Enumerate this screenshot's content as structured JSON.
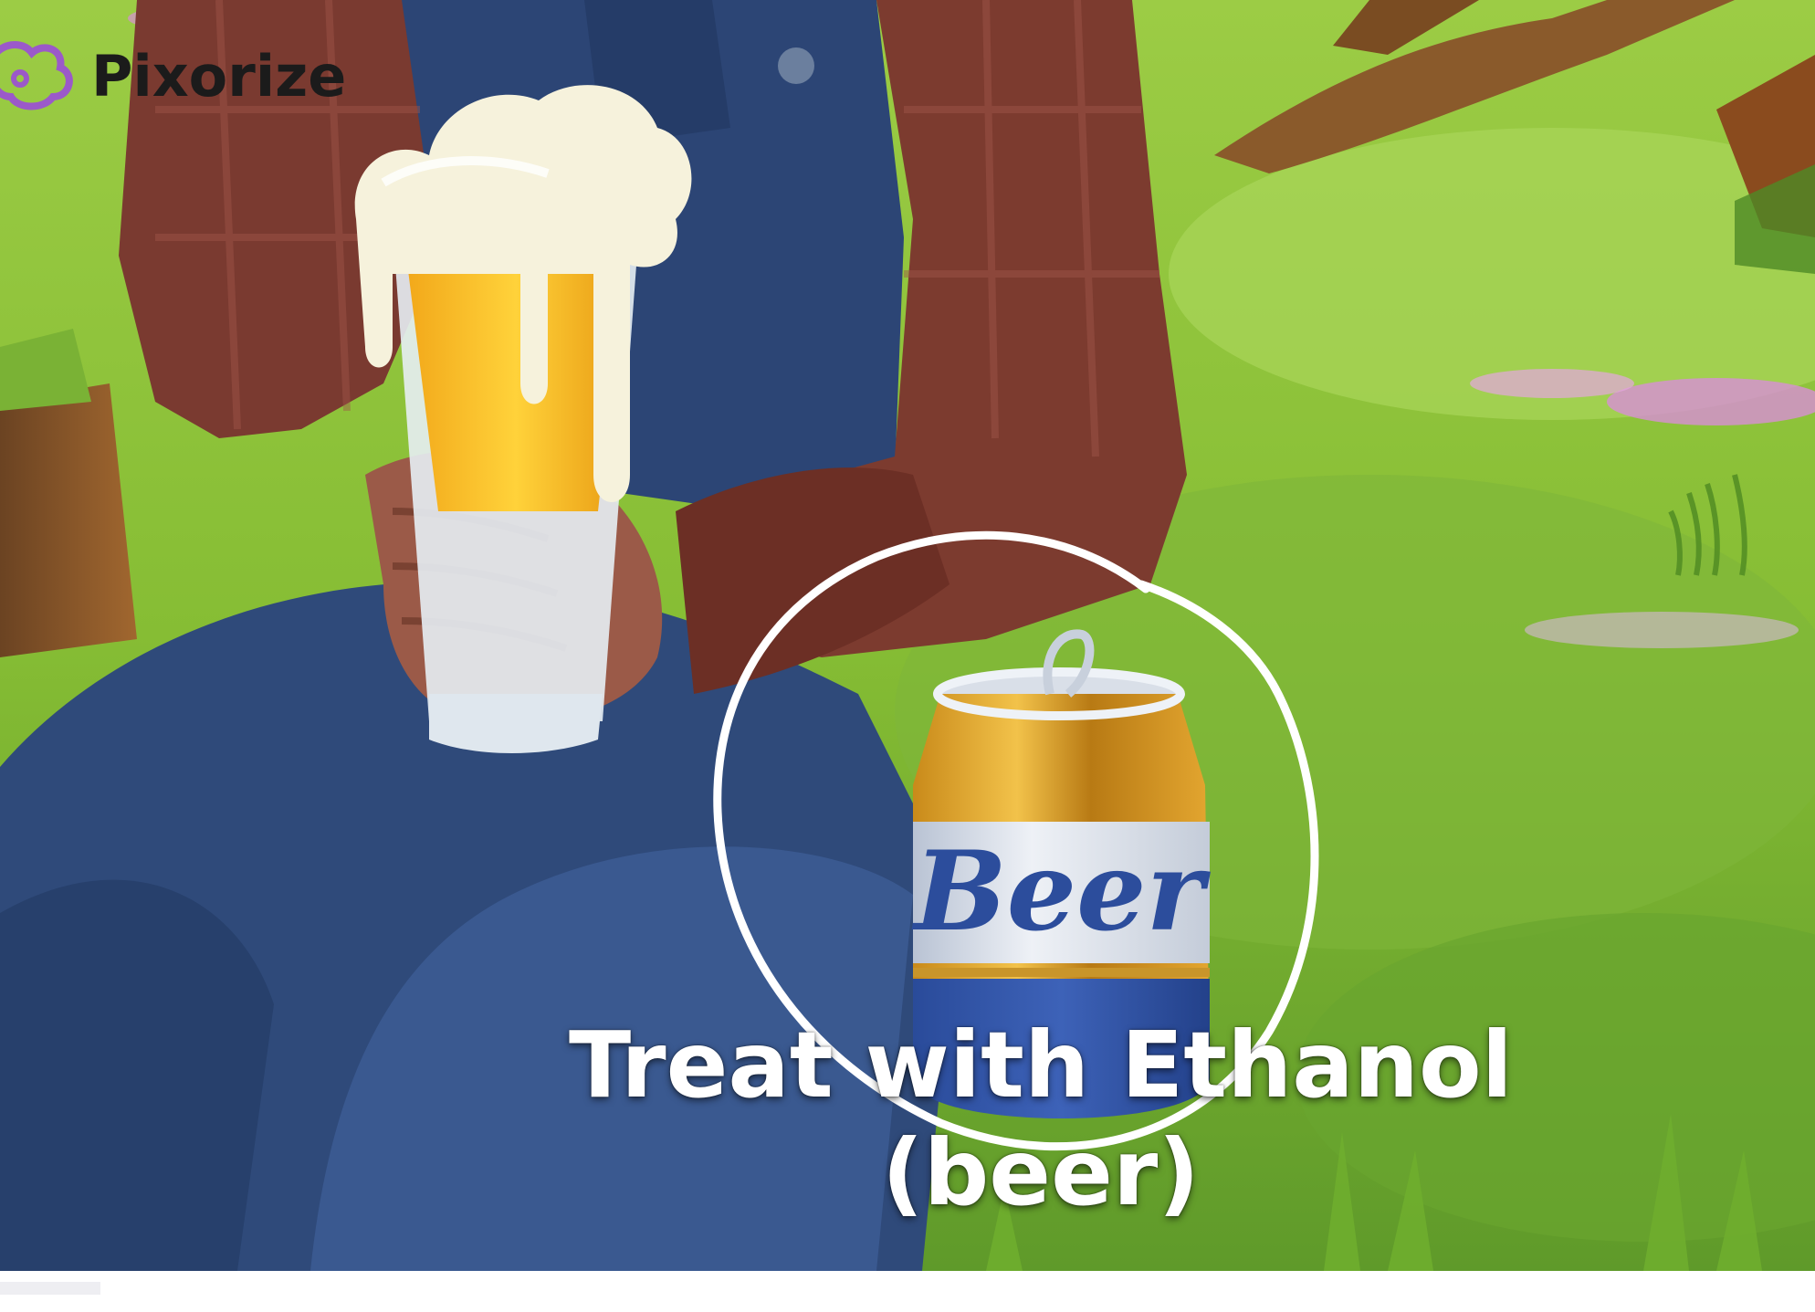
{
  "brand": {
    "name": "Pixorize",
    "logo_icon": "pixorize-cloud-logo-icon",
    "logo_color": "#9b59c9"
  },
  "caption": {
    "line1": "Treat with Ethanol",
    "line2": "(beer)"
  },
  "can": {
    "label": "Beer"
  },
  "colors": {
    "caption_text": "#ffffff",
    "annotation_circle": "#ffffff",
    "grass": "#8fc43a",
    "overalls": "#2f4a7a",
    "shirt": "#7a3a30"
  }
}
